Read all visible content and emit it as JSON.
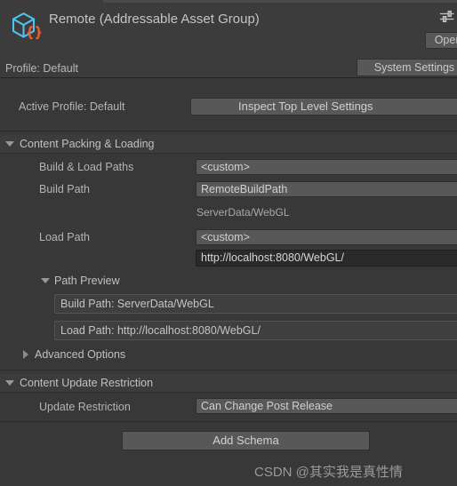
{
  "window": {
    "title": "Remote (Addressable Asset Group)",
    "icon": "addressable-asset-group-icon",
    "settings_icon": "sliders-settings-icon"
  },
  "header": {
    "open_button": "Open",
    "profile_label": "Profile: Default",
    "system_settings_button": "System Settings"
  },
  "active_profile": {
    "label": "Active Profile: Default",
    "inspect_button": "Inspect Top Level Settings"
  },
  "content_packing": {
    "section_title": "Content Packing & Loading",
    "expanded": true,
    "build_load_paths": {
      "label": "Build & Load Paths",
      "value": "<custom>"
    },
    "build_path": {
      "label": "Build Path",
      "value": "RemoteBuildPath",
      "helper": "ServerData/WebGL"
    },
    "load_path": {
      "label": "Load Path",
      "value": "<custom>",
      "url": "http://localhost:8080/WebGL/"
    },
    "path_preview": {
      "title": "Path Preview",
      "expanded": true,
      "build_path_preview": "Build Path: ServerData/WebGL",
      "load_path_preview": "Load Path: http://localhost:8080/WebGL/"
    },
    "advanced_options": {
      "title": "Advanced Options",
      "expanded": false
    }
  },
  "content_update_restriction": {
    "section_title": "Content Update Restriction",
    "expanded": true,
    "update_restriction": {
      "label": "Update Restriction",
      "value": "Can Change Post Release"
    }
  },
  "footer": {
    "add_schema_button": "Add Schema"
  },
  "watermark": {
    "text": "CSDN @其实我是真性情"
  },
  "colors": {
    "background": "#383838",
    "header_background": "#3c3c3c",
    "button": "#585858",
    "text": "#b4b4b4",
    "icon_blue": "#4ec3ee",
    "icon_orange": "#f25c31",
    "text_field": "#2a2a2a"
  }
}
